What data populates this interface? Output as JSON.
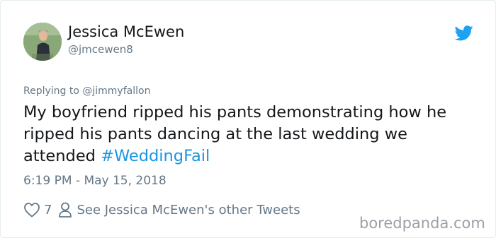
{
  "tweet": {
    "author": {
      "display_name": "Jessica McEwen",
      "handle": "@jmcewen8"
    },
    "replying_to": "Replying to @jimmyfallon",
    "text_main": "My boyfriend ripped his pants demonstrating how he ripped his pants dancing at the last wedding we attended ",
    "hashtag": "#WeddingFail",
    "timestamp": "6:19 PM - May 15, 2018",
    "like_count": "7",
    "other_tweets_link": "See Jessica McEwen's other Tweets"
  },
  "icons": {
    "brand": "twitter-bird-icon",
    "like": "heart-icon",
    "profile": "person-icon"
  },
  "watermark": "boredpanda.com",
  "colors": {
    "twitter_blue": "#1da1f2",
    "hashtag": "#1b95e0",
    "secondary_text": "#657786",
    "primary_text": "#14171a"
  }
}
